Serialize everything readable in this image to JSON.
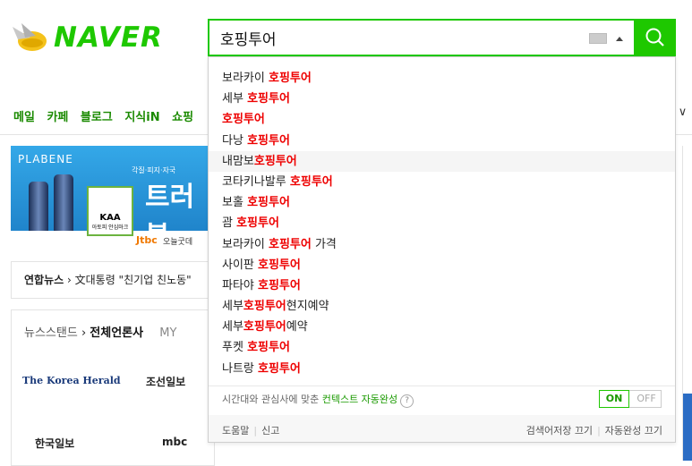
{
  "header": {
    "logo_text": "NAVER",
    "search_value": "호핑투어",
    "icons": {
      "keyboard": "keyboard-icon",
      "dropdown": "caret-up-icon",
      "search": "magnifier-icon"
    }
  },
  "nav": {
    "items": [
      "메일",
      "카페",
      "블로그",
      "지식iN",
      "쇼핑"
    ],
    "more": "l ∨"
  },
  "banner": {
    "brand": "PLABENE",
    "small": "각질·피지·자국",
    "big": "트러블",
    "kaa": "KAA",
    "kaa_sub": "아토피 안심마크",
    "jtbc": "Jtbc",
    "today": "오늘굿데"
  },
  "news": {
    "source": "연합뉴스",
    "headline": "文대통령 \"친기업 친노동\""
  },
  "newsstand": {
    "tab": "뉴스스탠드",
    "active": "전체언론사",
    "my": "MY",
    "press": [
      "The Korea Herald",
      "조선일보",
      "한국일보",
      "mbc"
    ]
  },
  "autocomplete": {
    "items": [
      {
        "pre": "보라카이 ",
        "kw": "호핑투어",
        "post": ""
      },
      {
        "pre": "세부 ",
        "kw": "호핑투어",
        "post": ""
      },
      {
        "pre": "",
        "kw": "호핑투어",
        "post": ""
      },
      {
        "pre": "다낭 ",
        "kw": "호핑투어",
        "post": ""
      },
      {
        "pre": "내맘보",
        "kw": "호핑투어",
        "post": ""
      },
      {
        "pre": "코타키나발루 ",
        "kw": "호핑투어",
        "post": ""
      },
      {
        "pre": "보홀 ",
        "kw": "호핑투어",
        "post": ""
      },
      {
        "pre": "괌 ",
        "kw": "호핑투어",
        "post": ""
      },
      {
        "pre": "보라카이 ",
        "kw": "호핑투어",
        "post": " 가격"
      },
      {
        "pre": "사이판 ",
        "kw": "호핑투어",
        "post": ""
      },
      {
        "pre": "파타야 ",
        "kw": "호핑투어",
        "post": ""
      },
      {
        "pre": "세부",
        "kw": "호핑투어",
        "post": "현지예약"
      },
      {
        "pre": "세부",
        "kw": "호핑투어",
        "post": "예약"
      },
      {
        "pre": "푸켓 ",
        "kw": "호핑투어",
        "post": ""
      },
      {
        "pre": "나트랑 ",
        "kw": "호핑투어",
        "post": ""
      }
    ],
    "highlighted_index": 4,
    "context_text": "시간대와 관심사에 맞춘 ",
    "context_link": "컨텍스트 자동완성",
    "help": "?",
    "toggle_on": "ON",
    "toggle_off": "OFF",
    "footer_help": "도움말",
    "footer_report": "신고",
    "footer_history_off": "검색어저장 끄기",
    "footer_autocomplete_off": "자동완성 끄기"
  }
}
